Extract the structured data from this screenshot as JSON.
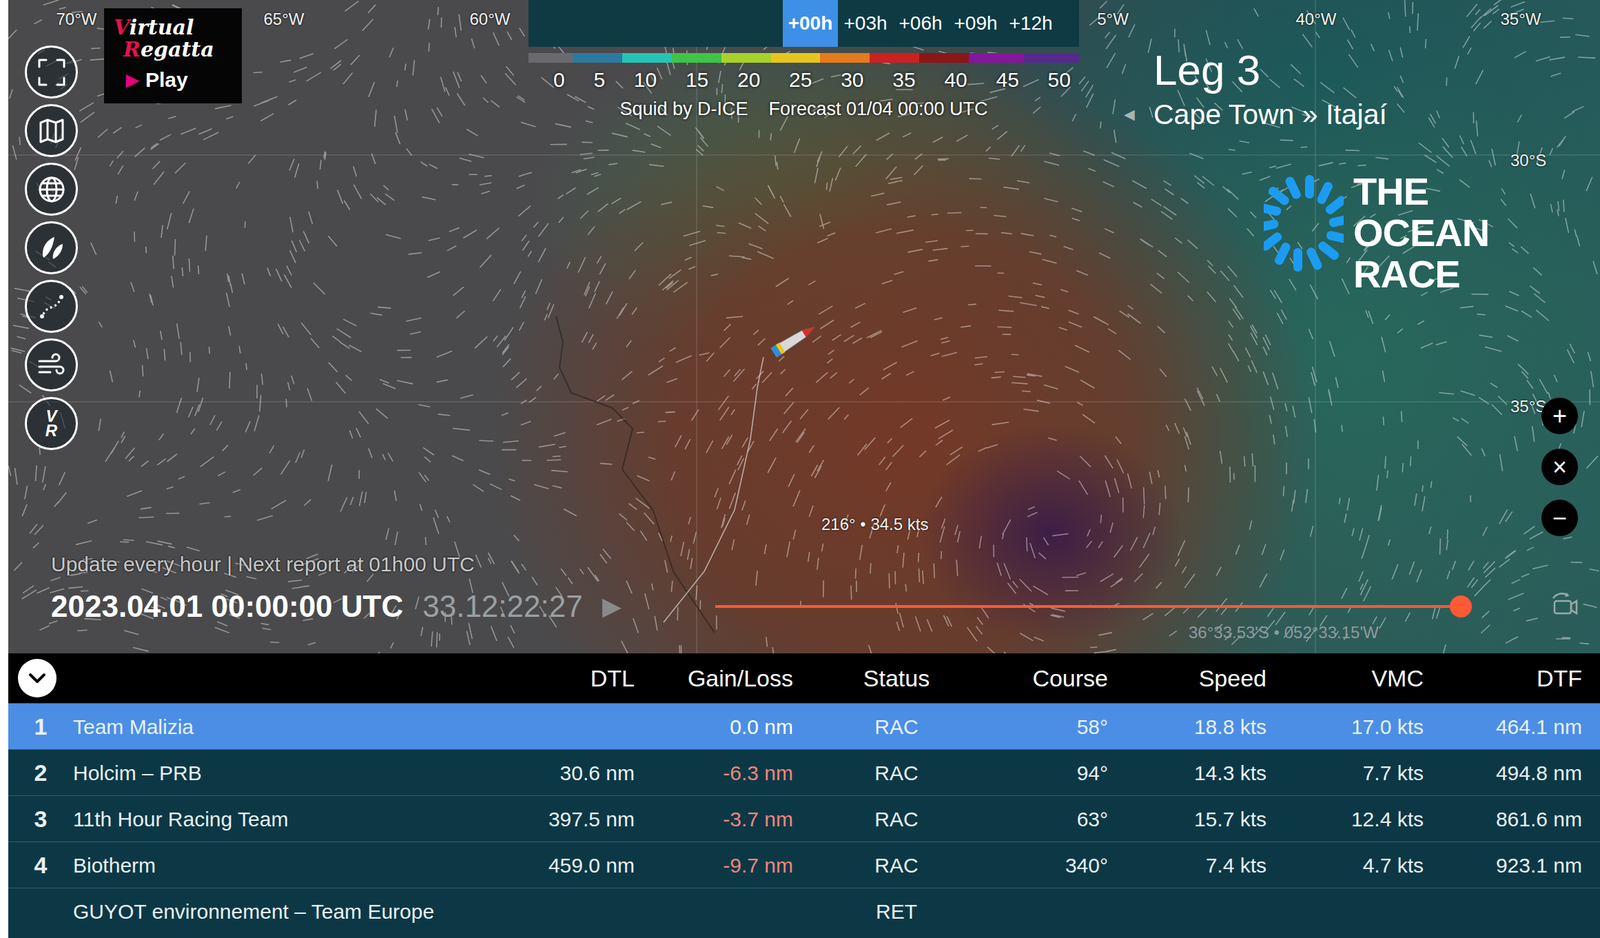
{
  "brand": {
    "line1": "Virtual",
    "line2": "Regatta",
    "play_icon": "▶",
    "play": "Play"
  },
  "toolbar": {
    "vr_letters": [
      "V",
      "R"
    ]
  },
  "map": {
    "longitudes": [
      "70°W",
      "65°W",
      "60°W",
      "5°W",
      "40°W",
      "35°W"
    ],
    "latitudes": [
      "30°S",
      "35°S"
    ],
    "wind_reading": "216° • 34.5 kts",
    "cursor_position": "36°33.53'S • 052°33.15'W"
  },
  "forecast": {
    "tabs": [
      {
        "label": "+00h",
        "selected": true
      },
      {
        "label": "+03h",
        "selected": false
      },
      {
        "label": "+06h",
        "selected": false
      },
      {
        "label": "+09h",
        "selected": false
      },
      {
        "label": "+12h",
        "selected": false
      }
    ],
    "scale": [
      "0",
      "5",
      "10",
      "15",
      "20",
      "25",
      "30",
      "35",
      "40",
      "45",
      "50"
    ],
    "credit": "Squid by D-ICE",
    "timestamp": "Forecast 01/04 00:00 UTC"
  },
  "leg": {
    "title": "Leg 3",
    "back_icon": "◄",
    "route": "Cape Town » Itajaí"
  },
  "race_logo": [
    "THE",
    "OCEAN",
    "RACE"
  ],
  "zoom": [
    "+",
    "×",
    "−"
  ],
  "timeline": {
    "update": "Update every hour | Next report at 01h00 UTC",
    "datetime": "2023.04.01 00:00:00 UTC",
    "elapsed": "33.12:22:27",
    "play_icon": "▶",
    "level": 1
  },
  "table": {
    "columns": [
      "DTL",
      "Gain/Loss",
      "Status",
      "Course",
      "Speed",
      "VMC",
      "DTF"
    ],
    "rows": [
      {
        "rank": "1",
        "name": "Team Malizia",
        "gain": "0.0 nm",
        "gain_color": "#ffffff",
        "status": "RAC",
        "course": "58°",
        "speed": "18.8 kts",
        "vmc": "17.0 kts",
        "dtf": "464.1 nm",
        "selected": true
      },
      {
        "rank": "2",
        "name": "Holcim – PRB",
        "dtl": "30.6 nm",
        "gain": "-6.3 nm",
        "gain_color": "#f2857a",
        "status": "RAC",
        "course": "94°",
        "speed": "14.3 kts",
        "vmc": "7.7 kts",
        "dtf": "494.8 nm",
        "selected": false
      },
      {
        "rank": "3",
        "name": "11th Hour Racing Team",
        "dtl": "397.5 nm",
        "gain": "-3.7 nm",
        "gain_color": "#f2857a",
        "status": "RAC",
        "course": "63°",
        "speed": "15.7 kts",
        "vmc": "12.4 kts",
        "dtf": "861.6 nm",
        "selected": false
      },
      {
        "rank": "4",
        "name": "Biotherm",
        "dtl": "459.0 nm",
        "gain": "-9.7 nm",
        "gain_color": "#f2857a",
        "status": "RAC",
        "course": "340°",
        "speed": "7.4 kts",
        "vmc": "4.7 kts",
        "dtf": "923.1 nm",
        "selected": false
      },
      {
        "name": "GUYOT environnement – Team Europe",
        "status": "RET",
        "selected": false
      }
    ]
  }
}
